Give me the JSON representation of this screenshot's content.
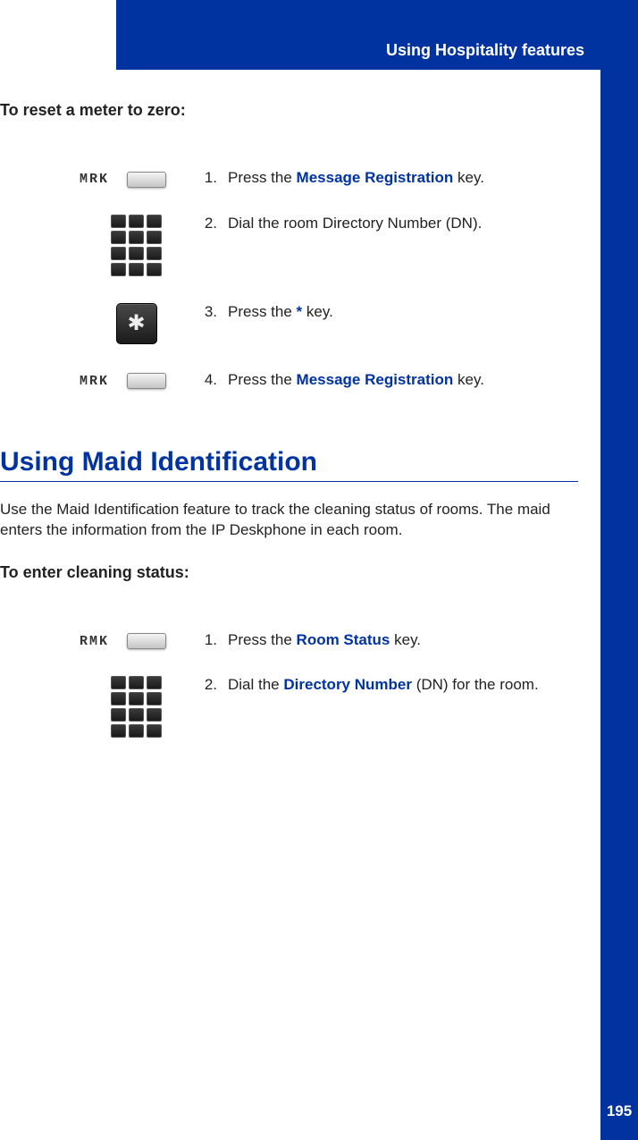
{
  "header": {
    "title": "Using Hospitality features"
  },
  "section1": {
    "proc_title": "To reset a meter to zero:",
    "steps": [
      {
        "num": "1.",
        "label": "MRK",
        "text_before": "Press the ",
        "bold": "Message Registration",
        "text_after": " key."
      },
      {
        "num": "2.",
        "label": "keypad",
        "text_before": "Dial the room Directory Number (DN).",
        "bold": "",
        "text_after": ""
      },
      {
        "num": "3.",
        "label": "star",
        "text_before": "Press the ",
        "bold": "*",
        "text_after": " key."
      },
      {
        "num": "4.",
        "label": "MRK",
        "text_before": "Press the ",
        "bold": "Message Registration",
        "text_after": " key."
      }
    ]
  },
  "section2": {
    "heading": "Using Maid Identification",
    "paragraph": "Use the Maid Identification feature to track the cleaning status of rooms. The maid enters the information from the IP Deskphone in each room.",
    "proc_title": "To enter cleaning status:",
    "steps": [
      {
        "num": "1.",
        "label": "RMK",
        "text_before": "Press the ",
        "bold": "Room Status",
        "text_after": " key."
      },
      {
        "num": "2.",
        "label": "keypad",
        "text_before": "Dial the ",
        "bold": "Directory Number",
        "text_after": " (DN) for the room."
      }
    ]
  },
  "page_number": "195"
}
